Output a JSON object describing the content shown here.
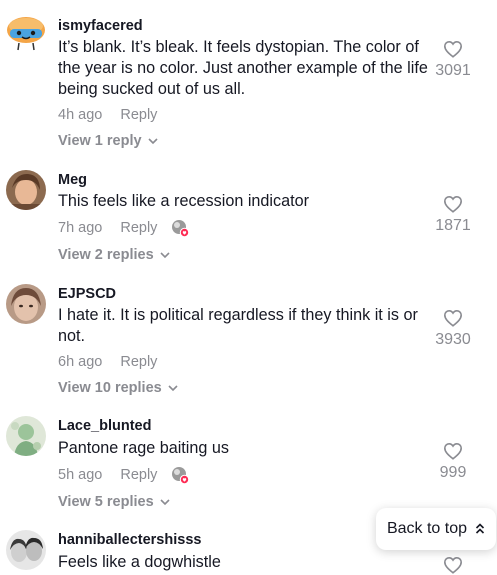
{
  "comments": [
    {
      "username": "ismyfacered",
      "text": "It’s blank. It’s bleak. It feels dystopian. The color of the year is no color. Just another example of the life being sucked out of us all.",
      "time": "4h ago",
      "reply": "Reply",
      "view_replies": "View 1 reply",
      "likes": "3091",
      "avatar_icon": "cartoon-face-avatar"
    },
    {
      "username": "Meg",
      "text": "This feels like a recession indicator",
      "time": "7h ago",
      "reply": "Reply",
      "view_replies": "View 2 replies",
      "likes": "1871",
      "avatar_icon": "photo-avatar"
    },
    {
      "username": "EJPSCD",
      "text": "I hate it. It is political regardless if they think it is or not.",
      "time": "6h ago",
      "reply": "Reply",
      "view_replies": "View 10 replies",
      "likes": "3930",
      "avatar_icon": "photo-avatar"
    },
    {
      "username": "Lace_blunted",
      "text": "Pantone rage baiting us",
      "time": "5h ago",
      "reply": "Reply",
      "view_replies": "View 5 replies",
      "likes": "999",
      "avatar_icon": "illustration-avatar"
    },
    {
      "username": "hanniballectershisss",
      "text": "Feels like a dogwhistle",
      "avatar_icon": "photo-avatar"
    }
  ],
  "back_to_top": "Back to top",
  "colors": {
    "text_primary": "#161823",
    "text_secondary": "#8a8b91",
    "creator_like_badge": "#fe2c55"
  }
}
